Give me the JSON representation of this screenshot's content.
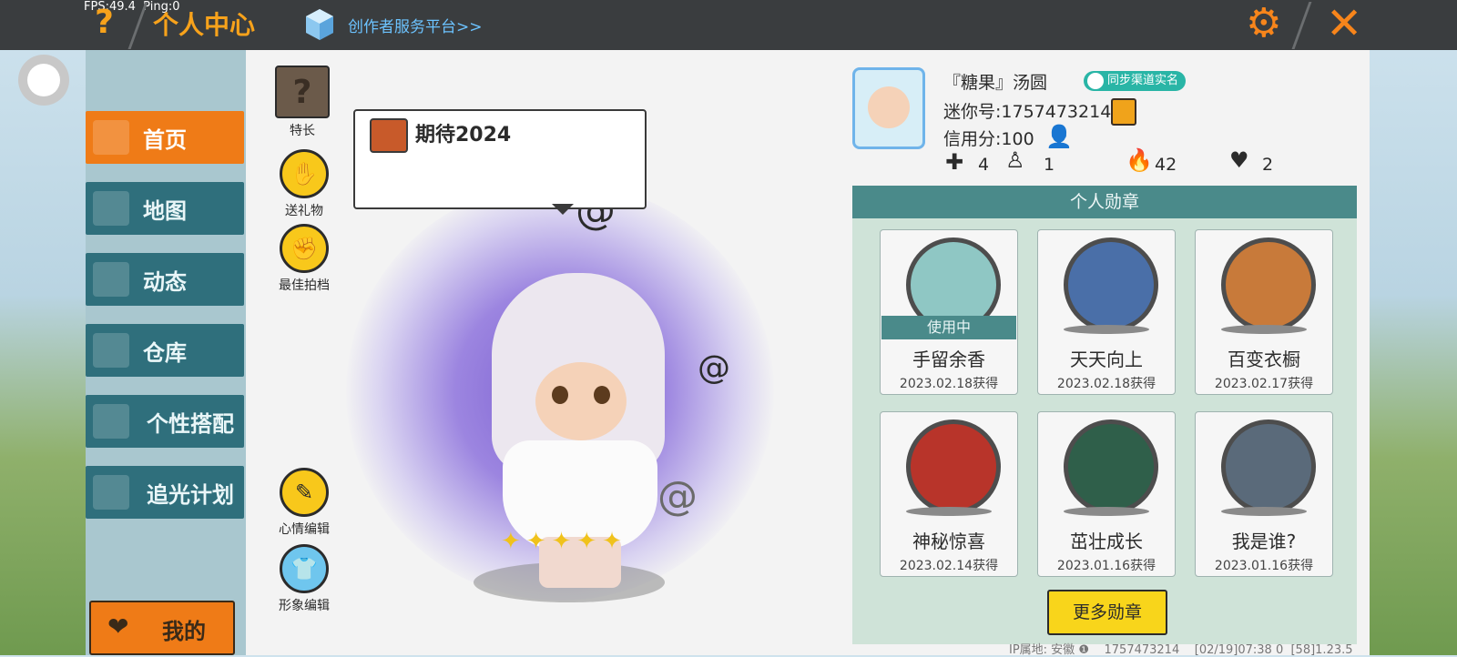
{
  "topbar": {
    "fps": "FPS:49.4  Ping:0",
    "title": "个人中心",
    "creator_link": "创作者服务平台>>"
  },
  "sidebar": {
    "items": [
      {
        "label": "首页",
        "active": true,
        "icon": "home-icon"
      },
      {
        "label": "地图",
        "active": false,
        "icon": "map-icon"
      },
      {
        "label": "动态",
        "active": false,
        "icon": "bell-icon"
      },
      {
        "label": "仓库",
        "active": false,
        "icon": "warehouse-icon"
      },
      {
        "label": "个性搭配",
        "active": false,
        "icon": "outfit-icon"
      },
      {
        "label": "追光计划",
        "active": false,
        "icon": "light-plan-icon"
      }
    ],
    "mine_label": "我的"
  },
  "tools": {
    "talent": "特长",
    "gift": "送礼物",
    "partner": "最佳拍档",
    "mood_edit": "心情编辑",
    "avatar_edit": "形象编辑"
  },
  "bubble": {
    "text": "期待2024"
  },
  "profile": {
    "nickname": "『糖果』汤圆",
    "realname_badge": "同步渠道实名",
    "mini_id": "迷你号:1757473214",
    "credit": "信用分:100",
    "stats": {
      "bookmarks": "4",
      "fans": "1",
      "heat": "42",
      "likes": "2"
    }
  },
  "medals": {
    "header": "个人勋章",
    "items": [
      {
        "name": "手留余香",
        "date": "2023.02.18获得",
        "in_use": "使用中",
        "color": "#8fc7c4"
      },
      {
        "name": "天天向上",
        "date": "2023.02.18获得",
        "color": "#4a6fa8"
      },
      {
        "name": "百变衣橱",
        "date": "2023.02.17获得",
        "color": "#c87a3a"
      },
      {
        "name": "神秘惊喜",
        "date": "2023.02.14获得",
        "color": "#b8342a"
      },
      {
        "name": "茁壮成长",
        "date": "2023.01.16获得",
        "color": "#2f5f4a"
      },
      {
        "name": "我是谁?",
        "date": "2023.01.16获得",
        "color": "#5a6a7a"
      }
    ],
    "more_label": "更多勋章"
  },
  "footer": {
    "text": "IP属地: 安徽 ❶    1757473214    [02/19]07:38 0  [58]1.23.5"
  },
  "colors": {
    "accent": "#f7a21b",
    "nav_active": "#ef7b17",
    "nav": "#2f6f7c",
    "medal_header": "#4a8a8a"
  }
}
